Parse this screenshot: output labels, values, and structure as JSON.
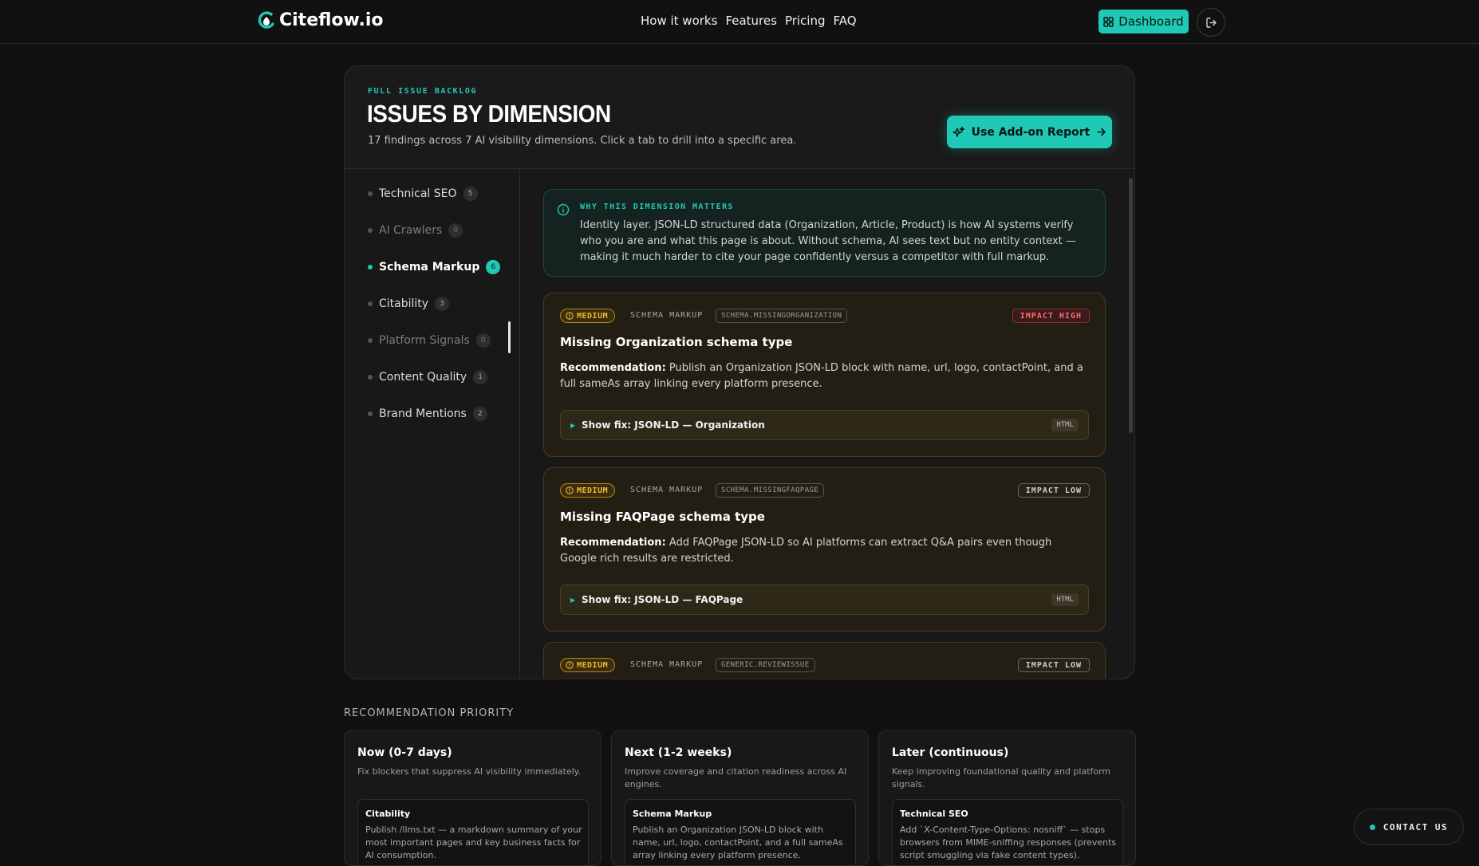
{
  "header": {
    "logo_text": "Citeflow.io",
    "nav": [
      "How it works",
      "Features",
      "Pricing",
      "FAQ"
    ],
    "dashboard_label": "Dashboard",
    "logout_icon": "logout-icon"
  },
  "panel": {
    "eyebrow": "FULL ISSUE BACKLOG",
    "title": "ISSUES BY DIMENSION",
    "subtitle": "17 findings across 7 AI visibility dimensions. Click a tab to drill into a specific area.",
    "addon_label": "Use Add-on Report"
  },
  "sidebar": {
    "items": [
      {
        "label": "Technical SEO",
        "count": "5",
        "state": "normal"
      },
      {
        "label": "AI Crawlers",
        "count": "0",
        "state": "dim"
      },
      {
        "label": "Schema Markup",
        "count": "6",
        "state": "active"
      },
      {
        "label": "Citability",
        "count": "3",
        "state": "normal"
      },
      {
        "label": "Platform Signals",
        "count": "0",
        "state": "dim"
      },
      {
        "label": "Content Quality",
        "count": "1",
        "state": "normal"
      },
      {
        "label": "Brand Mentions",
        "count": "2",
        "state": "normal"
      }
    ]
  },
  "why": {
    "eyebrow": "WHY THIS DIMENSION MATTERS",
    "text": "Identity layer. JSON-LD structured data (Organization, Article, Product) is how AI systems verify who you are and what this page is about. Without schema, AI sees text but no entity context — making it much harder to cite your page confidently versus a competitor with full markup."
  },
  "issues": [
    {
      "severity": "MEDIUM",
      "dimension": "SCHEMA MARKUP",
      "code": "SCHEMA.MISSINGORGANIZATION",
      "impact": "IMPACT HIGH",
      "impact_level": "high",
      "title": "Missing Organization schema type",
      "rec_label": "Recommendation:",
      "recommendation": "Publish an Organization JSON-LD block with name, url, logo, contactPoint, and a full sameAs array linking every platform presence.",
      "fix_label": "Show fix: JSON-LD — Organization",
      "fix_tag": "HTML"
    },
    {
      "severity": "MEDIUM",
      "dimension": "SCHEMA MARKUP",
      "code": "SCHEMA.MISSINGFAQPAGE",
      "impact": "IMPACT LOW",
      "impact_level": "low",
      "title": "Missing FAQPage schema type",
      "rec_label": "Recommendation:",
      "recommendation": "Add FAQPage JSON-LD so AI platforms can extract Q&A pairs even though Google rich results are restricted.",
      "fix_label": "Show fix: JSON-LD — FAQPage",
      "fix_tag": "HTML"
    },
    {
      "severity": "MEDIUM",
      "dimension": "SCHEMA MARKUP",
      "code": "GENERIC.REVIEWISSUE",
      "impact": "IMPACT LOW",
      "impact_level": "low"
    }
  ],
  "priority": {
    "heading": "RECOMMENDATION PRIORITY",
    "cards": [
      {
        "title": "Now (0-7 days)",
        "desc": "Fix blockers that suppress AI visibility immediately.",
        "item_title": "Citability",
        "item_text": "Publish /llms.txt — a markdown summary of your most important pages and key business facts for AI consumption."
      },
      {
        "title": "Next (1-2 weeks)",
        "desc": "Improve coverage and citation readiness across AI engines.",
        "item_title": "Schema Markup",
        "item_text": "Publish an Organization JSON-LD block with name, url, logo, contactPoint, and a full sameAs array linking every platform presence."
      },
      {
        "title": "Later (continuous)",
        "desc": "Keep improving foundational quality and platform signals.",
        "item_title": "Technical SEO",
        "item_text": "Add `X-Content-Type-Options: nosniff` — stops browsers from MIME-sniffing responses (prevents script smuggling via fake content types)."
      }
    ]
  },
  "contact_label": "CONTACT US",
  "colors": {
    "accent": "#1fc9b6",
    "warning": "#f2b632",
    "danger": "#ff6b6b",
    "background": "#111111"
  }
}
